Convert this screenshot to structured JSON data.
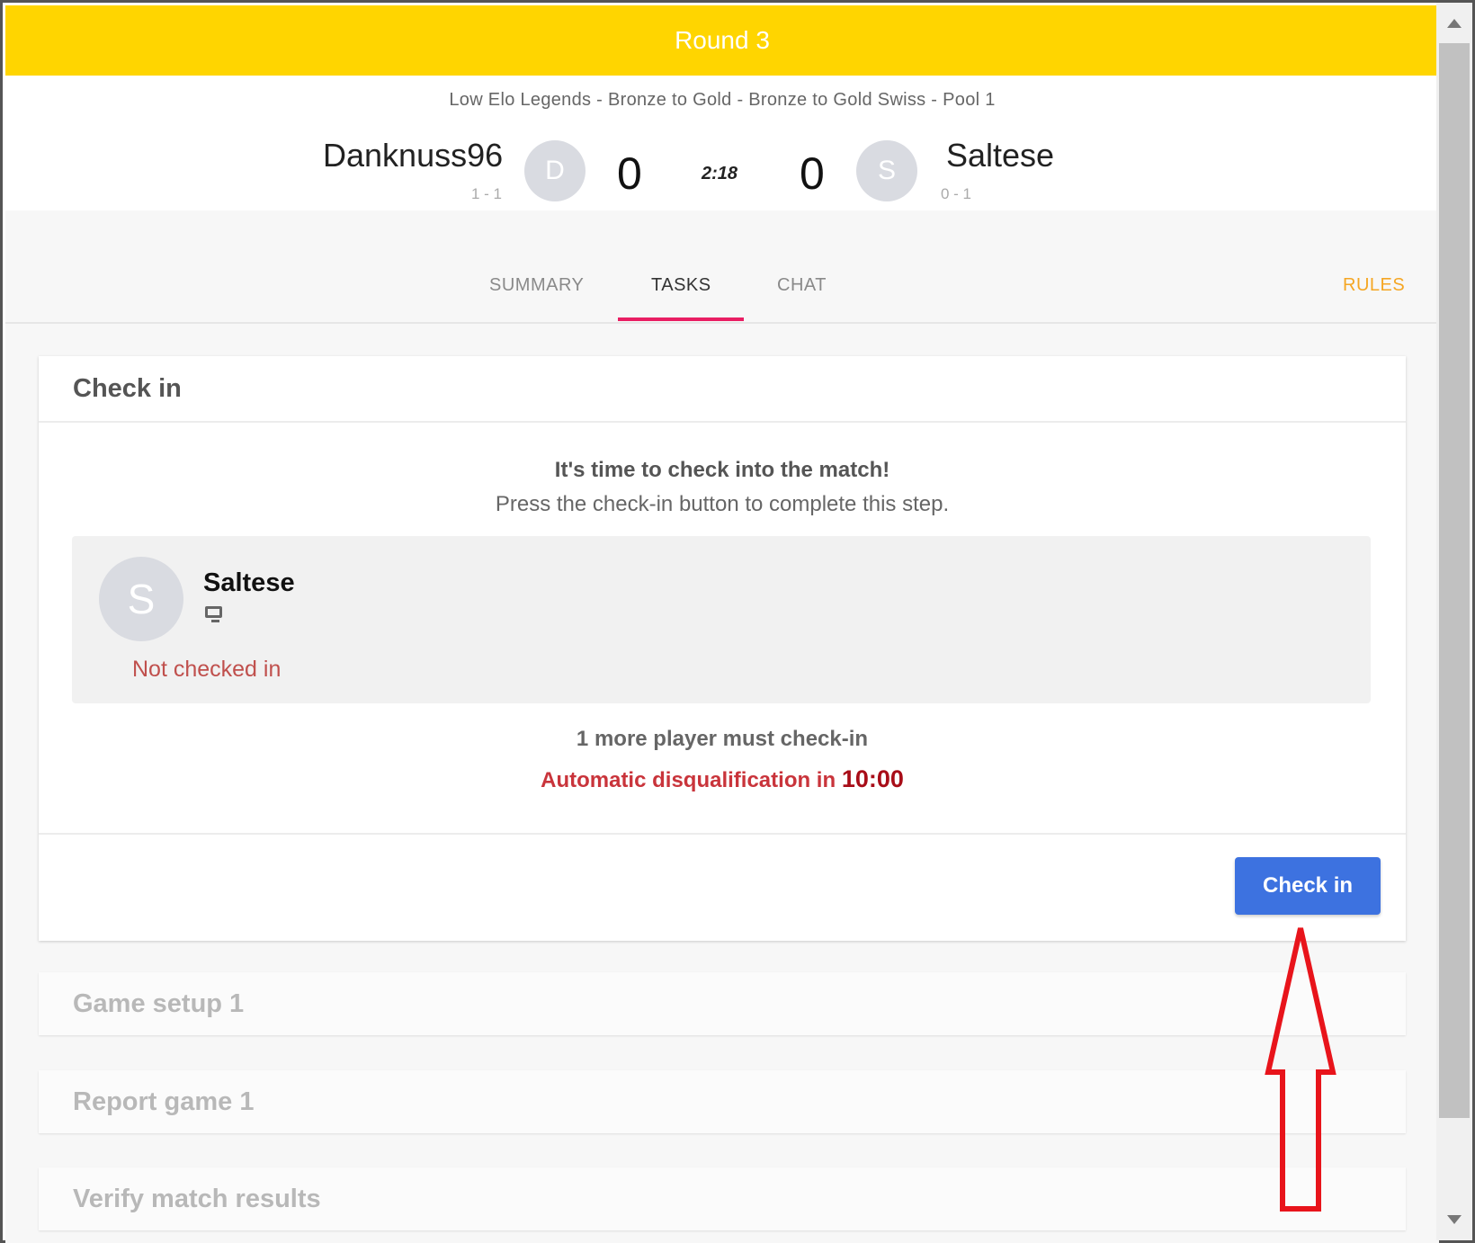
{
  "round": {
    "title": "Round 3"
  },
  "match": {
    "tournament": "Low Elo Legends - Bronze to Gold - Bronze to Gold Swiss - Pool 1",
    "clock": "2:18",
    "player1": {
      "name": "Danknuss96",
      "record": "1 - 1",
      "initial": "D",
      "score": "0"
    },
    "player2": {
      "name": "Saltese",
      "record": "0 - 1",
      "initial": "S",
      "score": "0"
    }
  },
  "tabs": {
    "summary": "SUMMARY",
    "tasks": "TASKS",
    "chat": "CHAT",
    "rules": "RULES",
    "active": "TASKS"
  },
  "checkin_card": {
    "title": "Check in",
    "message_line1": "It's time to check into the match!",
    "message_line2": "Press the check-in button to complete this step.",
    "player": {
      "initial": "S",
      "name": "Saltese",
      "platform_icon": "computer-icon",
      "status": "Not checked in"
    },
    "remaining": "1 more player must check-in",
    "disqualification_label": "Automatic disqualification in",
    "disqualification_time": "10:00",
    "button_label": "Check in"
  },
  "tasks": [
    {
      "label": "Game setup 1"
    },
    {
      "label": "Report game 1"
    },
    {
      "label": "Verify match results"
    }
  ],
  "colors": {
    "round_bar": "#ffd500",
    "active_tab_underline": "#e91e63",
    "rules": "#f5a623",
    "checkin_button": "#3d72e0",
    "not_checked_in": "#c0504d",
    "disqualification": "#c9343b",
    "annotation_arrow": "#e8141b"
  }
}
